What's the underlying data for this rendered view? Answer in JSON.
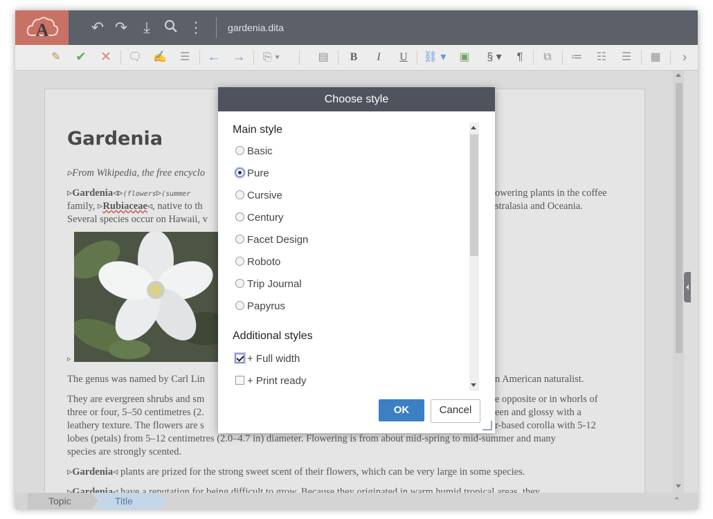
{
  "app": {
    "filename": "gardenia.dita"
  },
  "document": {
    "title": "Gardenia",
    "source_note": "From Wikipedia, the free encyclo",
    "para1_line1_a": "Gardenia",
    "para1_line1_b": "(flowers",
    "para1_line1_c": "(summer",
    "para1_line1_right": "owering plants in the coffee",
    "para1_line2_a": "family,",
    "para1_line2_b": "Rubiaceae",
    "para1_line2_c": ", native to th",
    "para1_line2_right": "stralasia and Oceania.",
    "para1_line3": "Several species occur on Hawaii, v",
    "para2_left": "The genus was named by Carl Lin",
    "para2_right": "n American naturalist.",
    "para3_l1_left": "They are evergreen shrubs and sm",
    "para3_l1_right": "e opposite or in whorls of",
    "para3_l2_left": "three or four, 5–50 centimetres (2.",
    "para3_l2_right": "een and glossy with a",
    "para3_l3_left": "leathery texture. The flowers are s",
    "para3_l3_right": "r-based corolla with 5-12",
    "para3_l4": "lobes (petals) from 5–12 centimetres (2.0–4.7 in) diameter. Flowering is from about mid-spring to mid-summer and many",
    "para3_l5": "species are strongly scented.",
    "para4_bold": "Gardenia",
    "para4_rest": "plants are prized for the strong sweet scent of their flowers, which can be very large in some species.",
    "para5_bold": "Gardenia",
    "para5_rest": "have a reputation for being difficult to grow. Because they originated in warm humid tropical areas, they"
  },
  "breadcrumb": [
    "Topic",
    "Title"
  ],
  "dialog": {
    "title": "Choose style",
    "main_heading": "Main style",
    "main_styles": [
      "Basic",
      "Pure",
      "Cursive",
      "Century",
      "Facet Design",
      "Roboto",
      "Trip Journal",
      "Papyrus"
    ],
    "selected_style": "Pure",
    "additional_heading": "Additional styles",
    "additional": [
      {
        "label": "+ Full width",
        "checked": true
      },
      {
        "label": "+ Print ready",
        "checked": false
      }
    ],
    "ok_label": "OK",
    "cancel_label": "Cancel"
  },
  "colors": {
    "topbar": "#4e535d",
    "logo_bg": "#c4675a",
    "ok_button": "#3c7fc3"
  }
}
